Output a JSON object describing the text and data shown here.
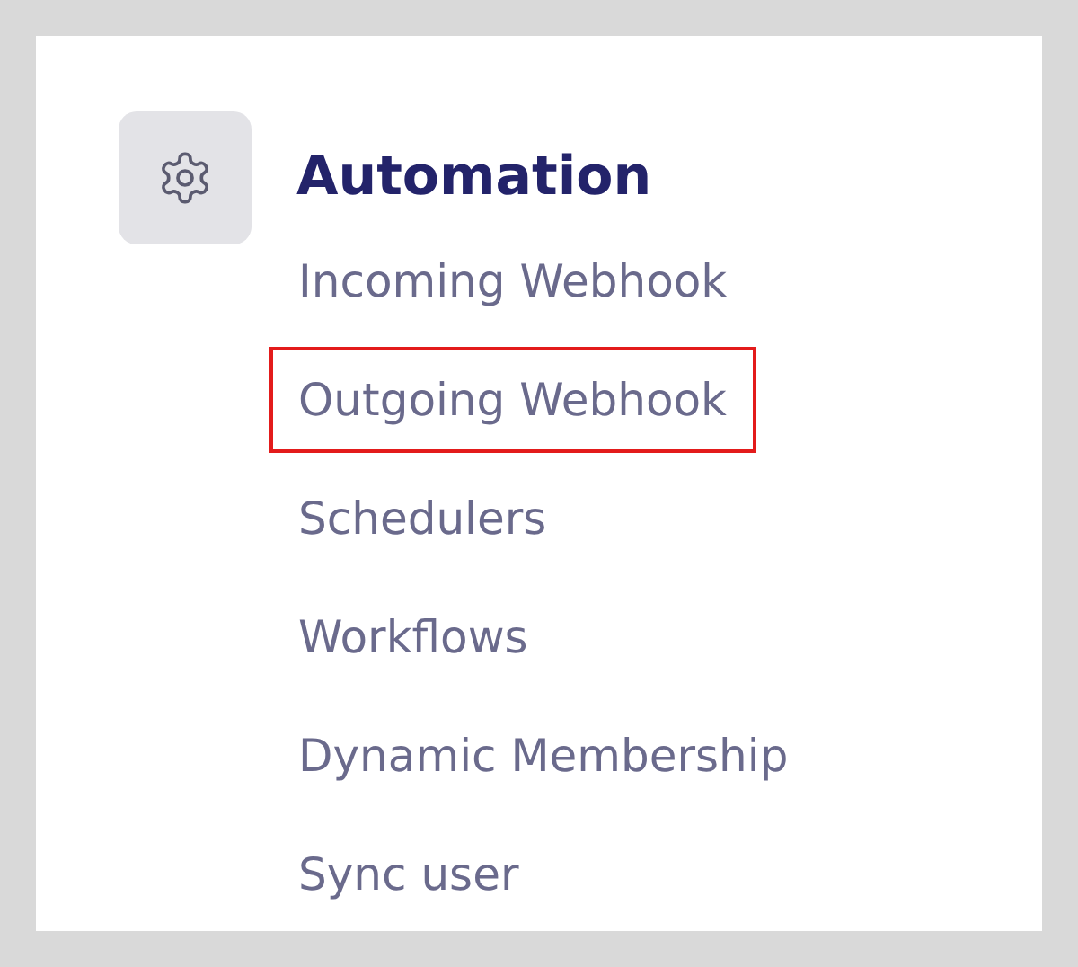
{
  "section": {
    "title": "Automation"
  },
  "items": [
    {
      "label": "Incoming Webhook",
      "selected": false
    },
    {
      "label": "Outgoing Webhook",
      "selected": true
    },
    {
      "label": "Schedulers",
      "selected": false
    },
    {
      "label": "Workflows",
      "selected": false
    },
    {
      "label": "Dynamic Membership",
      "selected": false
    },
    {
      "label": "Sync user",
      "selected": false
    }
  ]
}
